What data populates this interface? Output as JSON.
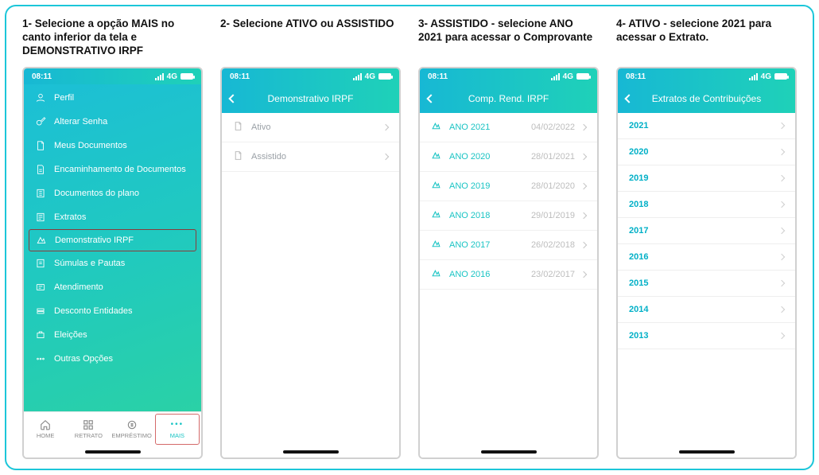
{
  "captions": {
    "c1": "1- Selecione a opção MAIS no canto inferior da tela e DEMONSTRATIVO IRPF",
    "c2": "2- Selecione ATIVO ou ASSISTIDO",
    "c3": "3- ASSISTIDO - selecione ANO 2021 para acessar o Comprovante",
    "c4": "4- ATIVO - selecione 2021 para acessar o Extrato."
  },
  "statusbar": {
    "time": "08:11",
    "net": "4G"
  },
  "screen1": {
    "menu": [
      {
        "label": "Perfil"
      },
      {
        "label": "Alterar Senha"
      },
      {
        "label": "Meus Documentos"
      },
      {
        "label": "Encaminhamento de Documentos"
      },
      {
        "label": "Documentos do plano"
      },
      {
        "label": "Extratos"
      },
      {
        "label": "Demonstrativo IRPF",
        "highlight": true
      },
      {
        "label": "Súmulas e Pautas"
      },
      {
        "label": "Atendimento"
      },
      {
        "label": "Desconto Entidades"
      },
      {
        "label": "Eleições"
      },
      {
        "label": "Outras Opções"
      }
    ],
    "bottomnav": {
      "home": "HOME",
      "retrato": "RETRATO",
      "emprestimo": "EMPRÉSTIMO",
      "mais": "MAIS"
    }
  },
  "screen2": {
    "title": "Demonstrativo IRPF",
    "rows": [
      {
        "label": "Ativo"
      },
      {
        "label": "Assistido"
      }
    ]
  },
  "screen3": {
    "title": "Comp. Rend. IRPF",
    "rows": [
      {
        "label": "ANO 2021",
        "date": "04/02/2022"
      },
      {
        "label": "ANO 2020",
        "date": "28/01/2021"
      },
      {
        "label": "ANO 2019",
        "date": "28/01/2020"
      },
      {
        "label": "ANO 2018",
        "date": "29/01/2019"
      },
      {
        "label": "ANO 2017",
        "date": "26/02/2018"
      },
      {
        "label": "ANO 2016",
        "date": "23/02/2017"
      }
    ]
  },
  "screen4": {
    "title": "Extratos de Contribuições",
    "years": [
      "2021",
      "2020",
      "2019",
      "2018",
      "2017",
      "2016",
      "2015",
      "2014",
      "2013"
    ]
  }
}
